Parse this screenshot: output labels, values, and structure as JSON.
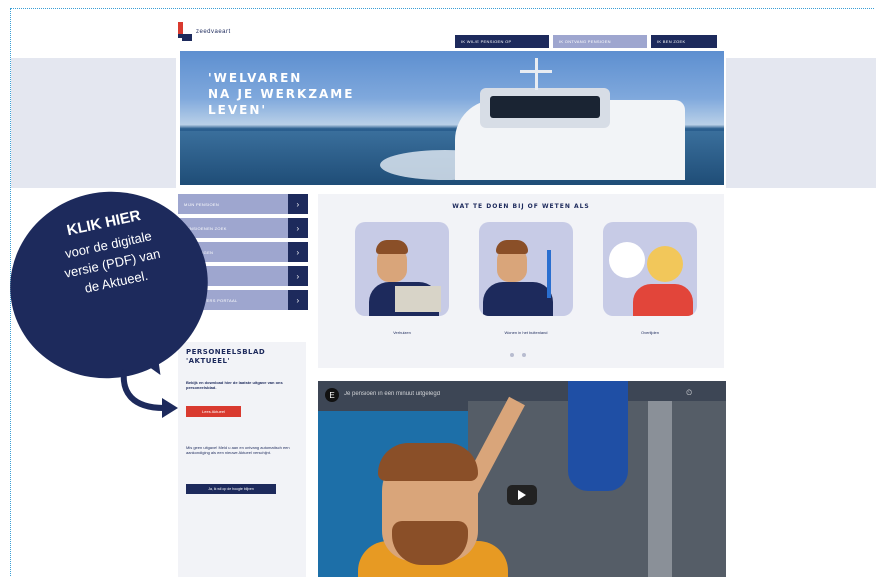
{
  "header": {
    "logo_text": "zeedvaeart",
    "nav": [
      {
        "label": "IK WIL/E PENSIOEN OP"
      },
      {
        "label": "IK ONTVANG PENSIOEN"
      },
      {
        "label": "IK BEN ZOEK"
      }
    ]
  },
  "hero": {
    "line1": "'WELVAREN",
    "line2": "NA JE WERKZAME",
    "line3": "LEVEN'"
  },
  "sidebar": {
    "items": [
      {
        "label": "MIJN PENSIOEN"
      },
      {
        "label": "PENSIOENEN ZOEK"
      },
      {
        "label": "REGELINGEN"
      },
      {
        "label": "CONTACT"
      },
      {
        "label": "WERKGEVERS PORTAAL"
      }
    ],
    "arrow": "›",
    "box": {
      "title_line1": "PERSONEELSBLAD",
      "title_line2": "'AKTUEEL'",
      "text": "Bekijk en download hier de laatste uitgave van ons personeelsblad.",
      "red_button": "Lees Aktueel",
      "text2": "Mis geen uitgave! Meld u aan en ontvang automatisch een aankondiging als een nieuwe Aktueel verschijnt.",
      "dark_button": "Ja, ik wil op de hoogte blijven"
    }
  },
  "center": {
    "title": "WAT TE DOEN BIJ OF WETEN ALS",
    "tiles": [
      {
        "caption": "Verhuizen"
      },
      {
        "caption": "Wonen in het buitenland"
      },
      {
        "caption": "Overlijden"
      }
    ]
  },
  "video": {
    "caption": "Je pensioen in één minuut uitgelegd",
    "side_label": "⏲"
  },
  "callout": {
    "headline": "KLIK HIER",
    "body_line1": "voor de digitale",
    "body_line2": "versie (PDF) van",
    "body_line3": "de Aktueel."
  },
  "colors": {
    "navy": "#1d2a5c",
    "lavender": "#9ea6cf",
    "red": "#d93a2f",
    "frame_dots": "#3a9fd6"
  }
}
